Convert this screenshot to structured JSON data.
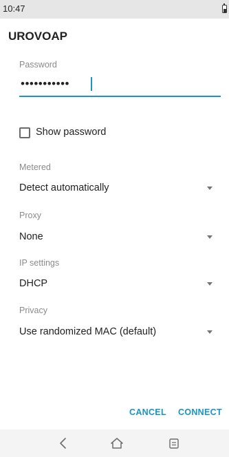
{
  "status_bar": {
    "time": "10:47",
    "battery_icon": "battery-icon"
  },
  "dialog": {
    "title": "UROVOAP",
    "password": {
      "label": "Password",
      "value": "•••••••••••",
      "accent_color": "#1a94c4"
    },
    "show_password": {
      "label": "Show password",
      "checked": false
    },
    "metered": {
      "label": "Metered",
      "value": "Detect automatically"
    },
    "proxy": {
      "label": "Proxy",
      "value": "None"
    },
    "ip_settings": {
      "label": "IP settings",
      "value": "DHCP"
    },
    "privacy": {
      "label": "Privacy",
      "value": "Use randomized MAC (default)"
    },
    "buttons": {
      "cancel": "CANCEL",
      "connect": "CONNECT"
    }
  },
  "nav_bar": {
    "icons": [
      "back-icon",
      "home-icon",
      "recents-icon"
    ]
  }
}
